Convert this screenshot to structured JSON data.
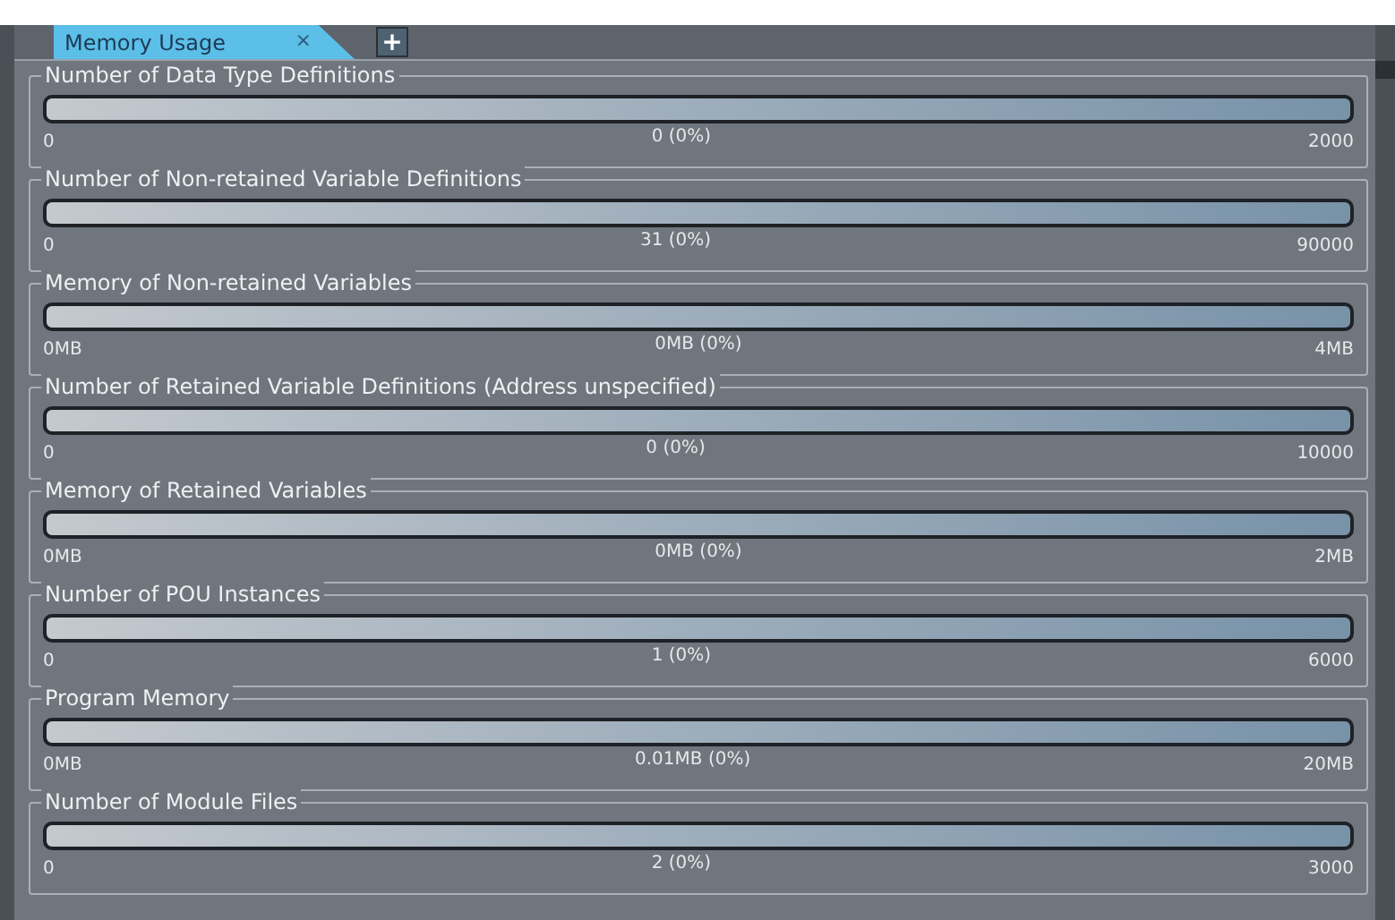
{
  "tabs": [
    {
      "label": "Memory Usage",
      "close": "×",
      "selected": true
    }
  ],
  "add_tab": "+",
  "meters": [
    {
      "title": "Number of Data Type Definitions",
      "level": 0,
      "min": "0",
      "reading": "0 (0%)",
      "max": "2000"
    },
    {
      "title": "Number of Non-retained Variable Definitions",
      "level": 0,
      "min": "0",
      "reading": "31 (0%)",
      "max": "90000"
    },
    {
      "title": "Memory of Non-retained Variables",
      "level": 0,
      "min": "0MB",
      "reading": "0MB (0%)",
      "max": "4MB"
    },
    {
      "title": "Number of Retained Variable Definitions (Address unspecified)",
      "level": 0,
      "min": "0",
      "reading": "0 (0%)",
      "max": "10000"
    },
    {
      "title": "Memory of Retained Variables",
      "level": 0,
      "min": "0MB",
      "reading": "0MB (0%)",
      "max": "2MB"
    },
    {
      "title": "Number of POU Instances",
      "level": 0,
      "min": "0",
      "reading": "1 (0%)",
      "max": "6000"
    },
    {
      "title": "Program Memory",
      "level": 0,
      "min": "0MB",
      "reading": "0.01MB (0%)",
      "max": "20MB"
    },
    {
      "title": "Number of Module Files",
      "level": 0,
      "min": "0",
      "reading": "2 (0%)",
      "max": "3000"
    }
  ]
}
